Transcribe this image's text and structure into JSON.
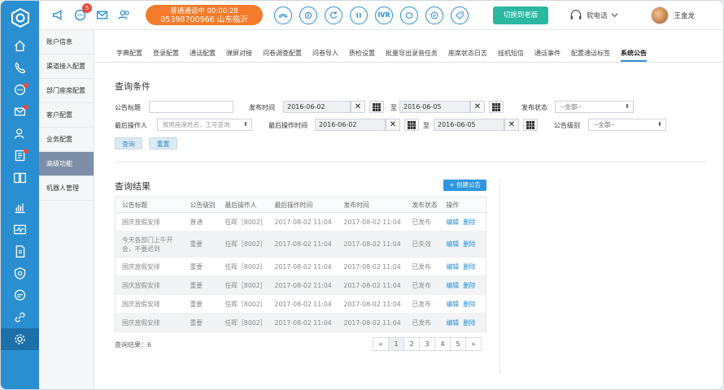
{
  "topbar": {
    "notification_count": "5",
    "call_status": "普通通话中  00:00:28",
    "call_number": "05398700966 山东临沂",
    "ivr_label": "IVR",
    "switch_label": "切换到老版",
    "phone_mode": "软电话",
    "user_name": "王金龙"
  },
  "sidemenu": {
    "items": [
      "账户信息",
      "渠道接入配置",
      "部门座席配置",
      "客户配置",
      "业务配置",
      "高级功能",
      "机器人管理"
    ],
    "active": "高级功能"
  },
  "tabs": [
    "字典配置",
    "登录配置",
    "通话配置",
    "弹屏对接",
    "问卷调查配置",
    "问卷导入",
    "质检设置",
    "批量导出录音任务",
    "座席状态日志",
    "挂机短信",
    "通话事件",
    "配置通话标签",
    "系统公告"
  ],
  "active_tab": "系统公告",
  "query": {
    "title": "查询条件",
    "notice_title_label": "公告标题",
    "publish_time_label": "发布时间",
    "publish_from": "2016-06-02",
    "to_label": "至",
    "publish_to": "2016-06-05",
    "publish_status_label": "发布状态",
    "publish_status_value": "--全部--",
    "last_operator_label": "最后操作人",
    "last_operator_placeholder": "按照座席姓名、工号查询",
    "last_op_time_label": "最后操作时间",
    "last_op_from": "2016-06-02",
    "last_op_to": "2016-06-05",
    "level_label": "公告级别",
    "level_value": "--全部--",
    "query_btn": "查询",
    "reset_btn": "重置"
  },
  "results": {
    "title": "查询结果",
    "create_btn": "+ 创建公告",
    "columns": [
      "公告标题",
      "公告级别",
      "最后操作人",
      "最后操作时间",
      "发布时间",
      "发布状态",
      "操作"
    ],
    "rows": [
      {
        "title": "国庆放假安排",
        "level": "普通",
        "operator": "任晖［8002］",
        "op_time": "2017-08-02 11:04",
        "pub_time": "2017-08-02 11:04",
        "status": "已发布",
        "edit": "编辑",
        "delete": "删除"
      },
      {
        "title": "今天各部门上午开会，不要迟到",
        "level": "重要",
        "operator": "任晖［8002］",
        "op_time": "2017-08-02 11:04",
        "pub_time": "2017-08-02 11:04",
        "status": "已失效",
        "edit": "编辑",
        "delete": "删除"
      },
      {
        "title": "国庆放假安排",
        "level": "重要",
        "operator": "任晖［8002］",
        "op_time": "2017-08-02 11:04",
        "pub_time": "2017-08-02 11:04",
        "status": "已发布",
        "edit": "编辑",
        "delete": "删除"
      },
      {
        "title": "国庆放假安排",
        "level": "重要",
        "operator": "任晖［8002］",
        "op_time": "2017-08-02 11:04",
        "pub_time": "2017-08-02 11:04",
        "status": "已发布",
        "edit": "编辑",
        "delete": "删除"
      },
      {
        "title": "国庆放假安排",
        "level": "重要",
        "operator": "任晖［8002］",
        "op_time": "2017-08-02 11:04",
        "pub_time": "2017-08-02 11:04",
        "status": "已发布",
        "edit": "编辑",
        "delete": "删除"
      },
      {
        "title": "国庆放假安排",
        "level": "重要",
        "operator": "任晖［8002］",
        "op_time": "2017-08-02 11:04",
        "pub_time": "2017-08-02 11:04",
        "status": "已发布",
        "edit": "编辑",
        "delete": "删除"
      }
    ],
    "total_label": "查询结果：6",
    "pager": [
      "«",
      "1",
      "2",
      "3",
      "4",
      "5",
      "»"
    ],
    "current_page": "1"
  },
  "colors": {
    "primary": "#2a8fd1",
    "call_orange": "#f37b2b",
    "switch_green": "#2ab8a0",
    "badge_red": "#e74c3c"
  }
}
